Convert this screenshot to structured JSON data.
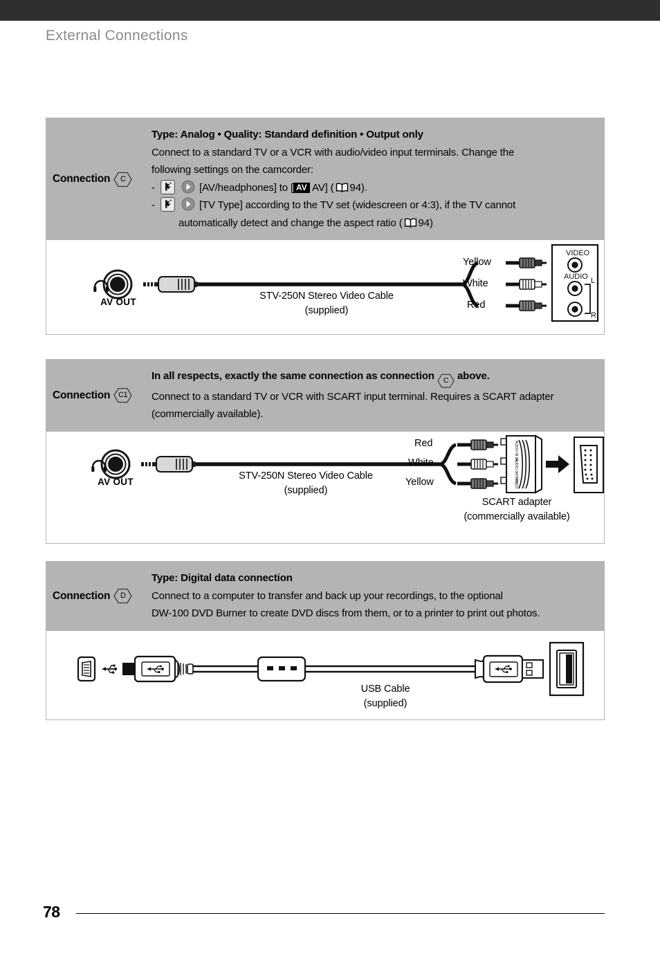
{
  "page": {
    "title": "External Connections",
    "number": "78"
  },
  "connections": [
    {
      "label": "Connection",
      "badge": "C",
      "lines": [
        {
          "text": "Type: Analog • Quality: Standard definition • Output only",
          "bold": true
        },
        {
          "text": "Connect to a standard TV or a VCR with audio/video input terminals. Change the"
        },
        {
          "text": "following settings on the camcorder:"
        }
      ],
      "bullets": [
        {
          "dash": "-",
          "pre": "[AV/headphones] to [",
          "badge": "AV",
          "mid": "AV] (",
          "page_ref": "94",
          "post": ")."
        },
        {
          "dash": "-",
          "pre": "[TV Type] according to the TV set (widescreen or 4:3), if the TV cannot",
          "cont_pre": "automatically detect and change the aspect ratio (",
          "page_ref": "94",
          "post": ")"
        }
      ],
      "diagram": {
        "port_label": "AV OUT",
        "cable_name": "STV-250N Stereo Video Cable",
        "cable_note": "(supplied)",
        "wires": [
          "Yellow",
          "White",
          "Red"
        ],
        "panel_labels": {
          "video": "VIDEO",
          "audio": "AUDIO",
          "left": "L",
          "right": "R"
        }
      }
    },
    {
      "label": "Connection",
      "badge": "C1",
      "lines": [
        {
          "text_pre": "In all respects, exactly the same connection as connection ",
          "inline_badge": "C",
          "text_post": " above.",
          "bold": true
        },
        {
          "text": "Connect to a standard TV or VCR with SCART input terminal. Requires a SCART adapter"
        },
        {
          "text": "(commercially available)."
        }
      ],
      "diagram": {
        "port_label": "AV OUT",
        "cable_name": "STV-250N Stereo Video Cable",
        "cable_note": "(supplied)",
        "wires": [
          "Red",
          "White",
          "Yellow"
        ],
        "adapter_name": "SCART adapter",
        "adapter_note": "(commercially available)",
        "adapter_ports": [
          "AUDIO IN (R)",
          "AUDIO (MONO)",
          "VIDEO"
        ]
      }
    },
    {
      "label": "Connection",
      "badge": "D",
      "lines": [
        {
          "text": "Type: Digital data connection",
          "bold": true
        },
        {
          "text": "Connect to a computer to transfer and back up your recordings, to the optional"
        },
        {
          "text": "DW-100 DVD Burner to create DVD discs from them, or to a printer to print out photos."
        }
      ],
      "diagram": {
        "cable_name": "USB Cable",
        "cable_note": "(supplied)"
      }
    }
  ],
  "colors": {
    "header_bar": "#2f2f2f",
    "block_header_gray": "#b4b4b4",
    "title_gray": "#8a8a8a"
  }
}
